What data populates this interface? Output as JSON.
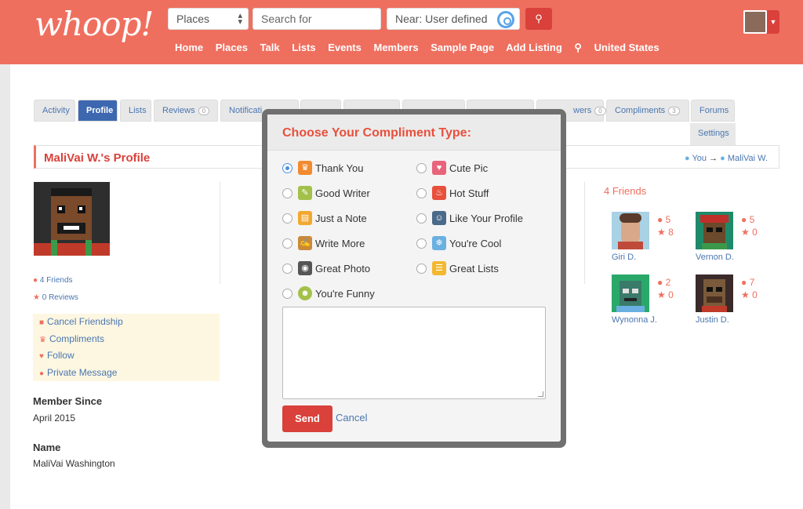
{
  "header": {
    "logo": "whoop!",
    "places_select": "Places",
    "search_placeholder": "Search for",
    "near_value": "Near: User defined",
    "nav": [
      "Home",
      "Places",
      "Talk",
      "Lists",
      "Events",
      "Members",
      "Sample Page",
      "Add Listing",
      "United States"
    ]
  },
  "tabs": [
    {
      "label": "Activity"
    },
    {
      "label": "Profile"
    },
    {
      "label": "Lists"
    },
    {
      "label": "Reviews",
      "badge": "0"
    },
    {
      "label": "Notificati"
    },
    {
      "label": "wers",
      "badge": "0"
    },
    {
      "label": "Compliments",
      "badge": "3"
    },
    {
      "label": "Forums"
    },
    {
      "label": "Settings"
    }
  ],
  "profile": {
    "title": "MaliVai W.'s Profile",
    "crumb_you": "You",
    "crumb_arrow": "→",
    "crumb_name": "MaliVai W.",
    "friends_link": "4 Friends",
    "reviews_link": "0 Reviews",
    "actions": [
      "Cancel Friendship",
      "Compliments",
      "Follow",
      "Private Message"
    ],
    "member_since_label": "Member Since",
    "member_since_value": "April 2015",
    "name_label": "Name",
    "name_value": "MaliVai Washington"
  },
  "friends": {
    "title": "4 Friends",
    "items": [
      {
        "name": "Giri D.",
        "friends": "5",
        "stars": "8"
      },
      {
        "name": "Vernon D.",
        "friends": "5",
        "stars": "0"
      },
      {
        "name": "Wynonna J.",
        "friends": "2",
        "stars": "0"
      },
      {
        "name": "Justin D.",
        "friends": "7",
        "stars": "0"
      }
    ]
  },
  "modal": {
    "title": "Choose Your Compliment Type:",
    "options": [
      {
        "label": "Thank You",
        "color": "#f28a30",
        "checked": true
      },
      {
        "label": "Cute Pic",
        "color": "#e8647a"
      },
      {
        "label": "Good Writer",
        "color": "#a3c14a"
      },
      {
        "label": "Hot Stuff",
        "color": "#e8503c"
      },
      {
        "label": "Just a Note",
        "color": "#f2a830"
      },
      {
        "label": "Like Your Profile",
        "color": "#4a6a8a"
      },
      {
        "label": "Write More",
        "color": "#c98a3a"
      },
      {
        "label": "You're Cool",
        "color": "#6ab0e0"
      },
      {
        "label": "Great Photo",
        "color": "#555555"
      },
      {
        "label": "Great Lists",
        "color": "#f2b830"
      },
      {
        "label": "You're Funny",
        "color": "#a3c14a"
      }
    ],
    "send": "Send",
    "cancel": "Cancel"
  }
}
